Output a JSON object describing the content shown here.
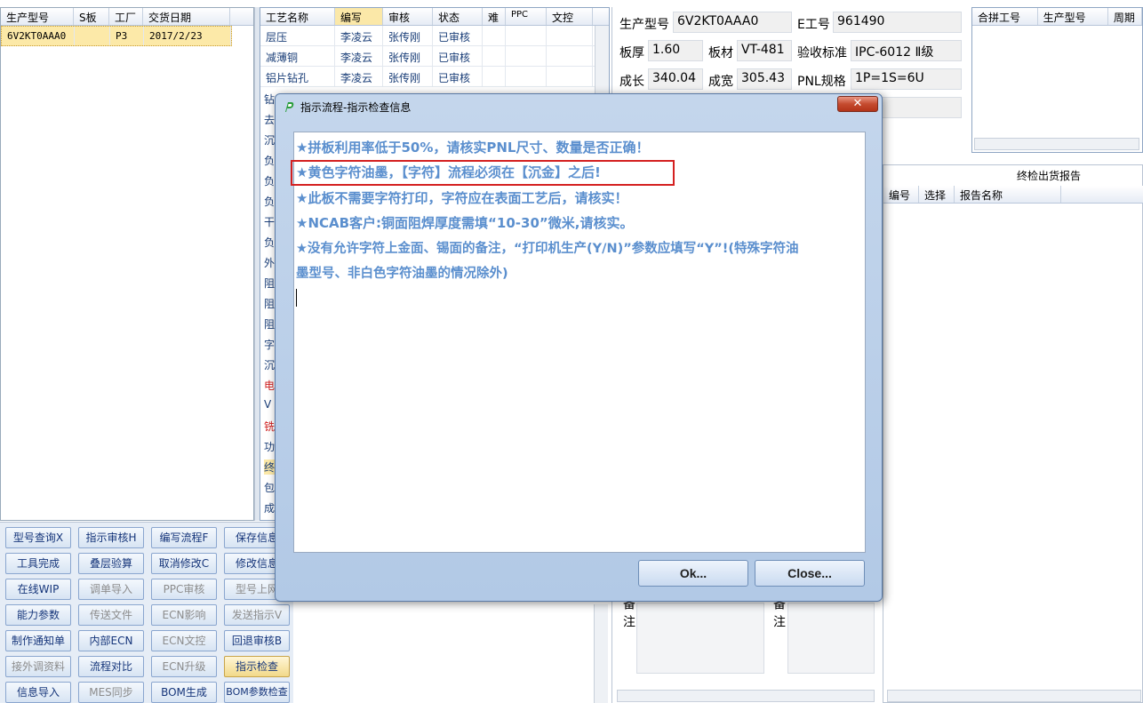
{
  "left_table": {
    "headers": [
      "生产型号",
      "S板",
      "工厂",
      "交货日期"
    ],
    "rows": [
      [
        "6V2KT0AAA0",
        "",
        "P3",
        "2017/2/23"
      ]
    ]
  },
  "process_table": {
    "headers": [
      "工艺名称",
      "编写",
      "审核",
      "状态",
      "难",
      "PPC",
      "文控"
    ],
    "rows": [
      [
        "层压",
        "李凌云",
        "张传刚",
        "已审核"
      ],
      [
        "减薄铜",
        "李凌云",
        "张传刚",
        "已审核"
      ],
      [
        "铝片钻孔",
        "李凌云",
        "张传刚",
        "已审核"
      ]
    ],
    "partial_items": [
      "钻",
      "去",
      "沉",
      "负",
      "负",
      "负",
      "干",
      "负",
      "外",
      "阻",
      "阻",
      "阻",
      "字",
      "沉",
      "电",
      "V",
      "铣",
      "功",
      "终",
      "包",
      "成"
    ]
  },
  "info": {
    "model_label": "生产型号",
    "model_value": "6V2KT0AAA0",
    "eno_label": "E工号",
    "eno_value": "961490",
    "thickness_label": "板厚",
    "thickness_value": "1.60",
    "material_label": "板材",
    "material_value": "VT-481",
    "standard_label": "验收标准",
    "standard_value": "IPC-6012 Ⅱ级",
    "length_label": "成长",
    "length_value": "340.04",
    "width_label": "成宽",
    "width_value": "305.43",
    "pnl_label": "PNL规格",
    "pnl_value": "1P=1S=6U"
  },
  "merge_table": {
    "headers": [
      "合拼工号",
      "生产型号",
      "周期"
    ]
  },
  "report": {
    "title": "终检出货报告",
    "headers": [
      "编号",
      "选择",
      "报告名称"
    ]
  },
  "remarks": {
    "label1": "备注",
    "label2": "备注"
  },
  "buttons": {
    "col1": [
      "型号查询X",
      "工具完成",
      "在线WIP",
      "能力参数",
      "制作通知单",
      "接外调资料",
      "信息导入"
    ],
    "col2": [
      "指示审核H",
      "叠层验算",
      "调单导入",
      "传送文件",
      "内部ECN",
      "流程对比",
      "MES同步"
    ],
    "col3": [
      "编写流程F",
      "取消修改C",
      "PPC审核",
      "ECN影响",
      "ECN文控",
      "ECN升级",
      "BOM生成"
    ],
    "col4": [
      "保存信息",
      "修改信息",
      "型号上网",
      "发送指示V",
      "回退审核B",
      "指示检查",
      "BOM参数检查"
    ]
  },
  "dialog": {
    "title": "指示流程-指示检查信息",
    "close_glyph": "✕",
    "messages": [
      "★拼板利用率低于50%，请核实PNL尺寸、数量是否正确！",
      "★黄色字符油墨，【字符】流程必须在【沉金】之后!",
      "★此板不需要字符打印，字符应在表面工艺后，请核实！",
      "★NCAB客户:铜面阻焊厚度需填“10-30”微米,请核实。",
      "★没有允许字符上金面、锡面的备注，“打印机生产(Y/N)”参数应填写“Y”!(特殊字符油",
      "墨型号、非白色字符油墨的情况除外)"
    ],
    "ok_label": "Ok...",
    "close_label": "Close...",
    "highlight_color": "#d42020"
  }
}
